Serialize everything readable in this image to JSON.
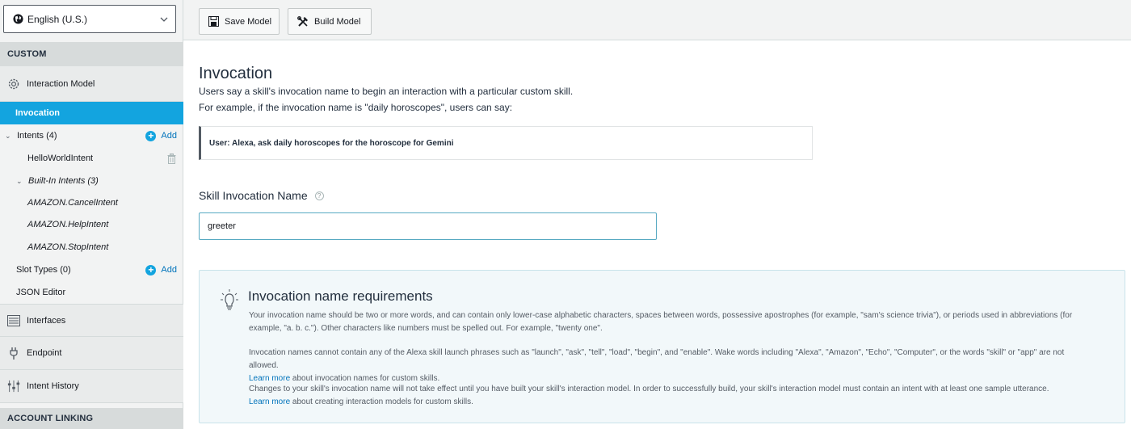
{
  "sidebar": {
    "locale": "English (U.S.)",
    "section_custom": "CUSTOM",
    "interaction_model": "Interaction Model",
    "invocation": "Invocation",
    "intents": "Intents (4)",
    "add": "Add",
    "hello_world_intent": "HelloWorldIntent",
    "built_in_intents": "Built-In Intents (3)",
    "cancel_intent": "AMAZON.CancelIntent",
    "help_intent": "AMAZON.HelpIntent",
    "stop_intent": "AMAZON.StopIntent",
    "slot_types": "Slot Types (0)",
    "json_editor": "JSON Editor",
    "interfaces": "Interfaces",
    "endpoint": "Endpoint",
    "intent_history": "Intent History",
    "section_account_linking": "ACCOUNT LINKING"
  },
  "toolbar": {
    "save_label": "Save Model",
    "build_label": "Build Model"
  },
  "main": {
    "title": "Invocation",
    "lead_1": "Users say a skill's invocation name to begin an interaction with a particular custom skill.",
    "lead_2": "For example, if the invocation name is \"daily horoscopes\", users can say:",
    "example": "User: Alexa, ask daily horoscopes for the horoscope for Gemini",
    "field_label": "Skill Invocation Name",
    "help_glyph": "?",
    "invocation_value": "greeter"
  },
  "requirements": {
    "title": "Invocation name requirements",
    "p1": "Your invocation name should be two or more words, and can contain only lower-case alphabetic characters, spaces between words, possessive apostrophes (for example, \"sam's science trivia\"), or periods used in abbreviations (for example, \"a. b. c.\"). Other characters like numbers must be spelled out. For example, \"twenty one\".",
    "p2": "Invocation names cannot contain any of the Alexa skill launch phrases such as \"launch\", \"ask\", \"tell\", \"load\", \"begin\", and \"enable\". Wake words including \"Alexa\", \"Amazon\", \"Echo\", \"Computer\", or the words \"skill\" or \"app\" are not allowed.",
    "learn_more": "Learn more",
    "p2_tail": " about invocation names for custom skills.",
    "p3": "Changes to your skill's invocation name will not take effect until you have built your skill's interaction model. In order to successfully build, your skill's interaction model must contain an intent with at least one sample utterance.",
    "p3_tail": " about creating interaction models for custom skills."
  },
  "colors": {
    "accent": "#13a4df",
    "link": "#0073bb",
    "sidebar_bg": "#f2f3f3"
  }
}
